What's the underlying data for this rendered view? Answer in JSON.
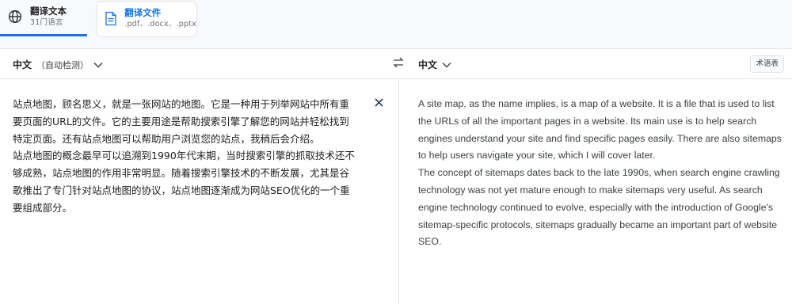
{
  "tabs": [
    {
      "title": "翻译文本",
      "subtitle": "31门语言",
      "icon": "globe-icon",
      "active": true
    },
    {
      "title": "翻译文件",
      "subtitle": ".pdf、.docx、.pptx",
      "icon": "document-icon",
      "active": false
    }
  ],
  "language_bar": {
    "source_language": "中文",
    "source_detect": "（自动检测）",
    "target_language": "中文",
    "swap_icon": "swap-arrows-icon",
    "glossary_label": "术语表"
  },
  "source": {
    "text": "站点地图，顾名思义，就是一张网站的地图。它是一种用于列举网站中所有重要页面的URL的文件。它的主要用途是帮助搜索引擎了解您的网站并轻松找到特定页面。还有站点地图可以帮助用户浏览您的站点，我稍后会介绍。\n站点地图的概念最早可以追溯到1990年代末期，当时搜索引擎的抓取技术还不够成熟，站点地图的作用非常明显。随着搜索引擎技术的不断发展，尤其是谷歌推出了专门针对站点地图的协议，站点地图逐渐成为网站SEO优化的一个重要组成部分。",
    "clear_icon": "close-icon"
  },
  "target": {
    "text": "A site map, as the name implies, is a map of a website. It is a file that is used to list the URLs of all the important pages in a website. Its main use is to help search engines understand your site and find specific pages easily. There are also sitemaps to help users navigate your site, which I will cover later.\nThe concept of sitemaps dates back to the late 1990s, when search engine crawling technology was not yet mature enough to make sitemaps very useful. As search engine technology continued to evolve, especially with the introduction of Google's sitemap-specific protocols, sitemaps gradually became an important part of website SEO."
  },
  "colors": {
    "accent": "#1a73e8",
    "divider": "#e2e5e9",
    "strip_bg": "#f8f9fb"
  }
}
